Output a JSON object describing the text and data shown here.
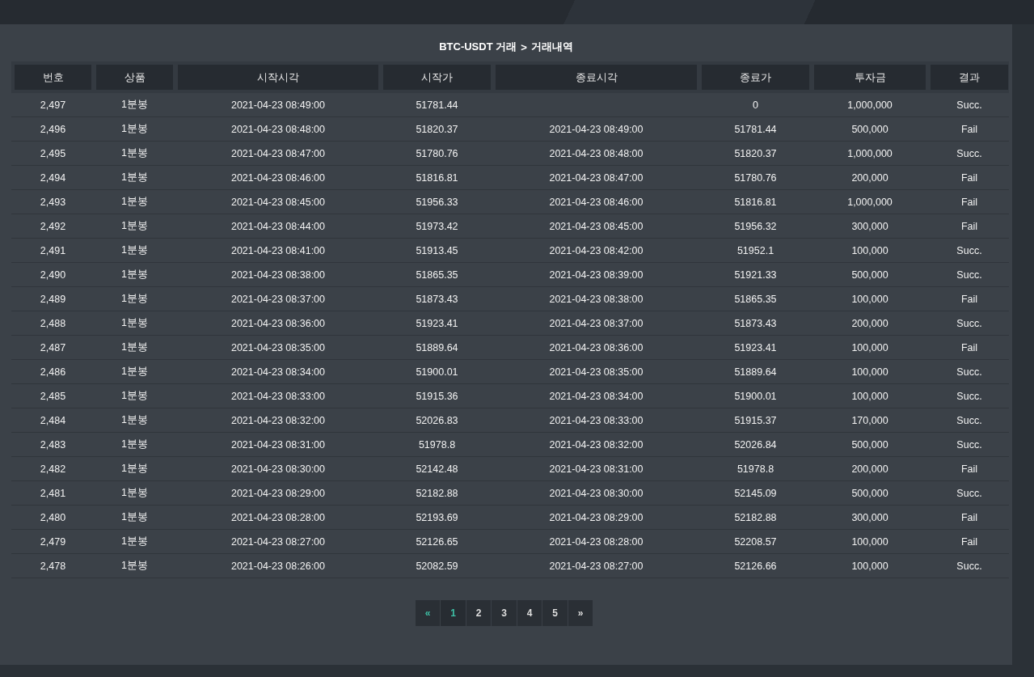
{
  "breadcrumb": {
    "title": "BTC-USDT 거래",
    "separator": ">",
    "current": "거래내역"
  },
  "table": {
    "columns": [
      "번호",
      "상품",
      "시작시각",
      "시작가",
      "종료시각",
      "종료가",
      "투자금",
      "결과"
    ],
    "rows": [
      [
        "2,497",
        "1분봉",
        "2021-04-23 08:49:00",
        "51781.44",
        "",
        "0",
        "1,000,000",
        "Succ."
      ],
      [
        "2,496",
        "1분봉",
        "2021-04-23 08:48:00",
        "51820.37",
        "2021-04-23 08:49:00",
        "51781.44",
        "500,000",
        "Fail"
      ],
      [
        "2,495",
        "1분봉",
        "2021-04-23 08:47:00",
        "51780.76",
        "2021-04-23 08:48:00",
        "51820.37",
        "1,000,000",
        "Succ."
      ],
      [
        "2,494",
        "1분봉",
        "2021-04-23 08:46:00",
        "51816.81",
        "2021-04-23 08:47:00",
        "51780.76",
        "200,000",
        "Fail"
      ],
      [
        "2,493",
        "1분봉",
        "2021-04-23 08:45:00",
        "51956.33",
        "2021-04-23 08:46:00",
        "51816.81",
        "1,000,000",
        "Fail"
      ],
      [
        "2,492",
        "1분봉",
        "2021-04-23 08:44:00",
        "51973.42",
        "2021-04-23 08:45:00",
        "51956.32",
        "300,000",
        "Fail"
      ],
      [
        "2,491",
        "1분봉",
        "2021-04-23 08:41:00",
        "51913.45",
        "2021-04-23 08:42:00",
        "51952.1",
        "100,000",
        "Succ."
      ],
      [
        "2,490",
        "1분봉",
        "2021-04-23 08:38:00",
        "51865.35",
        "2021-04-23 08:39:00",
        "51921.33",
        "500,000",
        "Succ."
      ],
      [
        "2,489",
        "1분봉",
        "2021-04-23 08:37:00",
        "51873.43",
        "2021-04-23 08:38:00",
        "51865.35",
        "100,000",
        "Fail"
      ],
      [
        "2,488",
        "1분봉",
        "2021-04-23 08:36:00",
        "51923.41",
        "2021-04-23 08:37:00",
        "51873.43",
        "200,000",
        "Succ."
      ],
      [
        "2,487",
        "1분봉",
        "2021-04-23 08:35:00",
        "51889.64",
        "2021-04-23 08:36:00",
        "51923.41",
        "100,000",
        "Fail"
      ],
      [
        "2,486",
        "1분봉",
        "2021-04-23 08:34:00",
        "51900.01",
        "2021-04-23 08:35:00",
        "51889.64",
        "100,000",
        "Succ."
      ],
      [
        "2,485",
        "1분봉",
        "2021-04-23 08:33:00",
        "51915.36",
        "2021-04-23 08:34:00",
        "51900.01",
        "100,000",
        "Succ."
      ],
      [
        "2,484",
        "1분봉",
        "2021-04-23 08:32:00",
        "52026.83",
        "2021-04-23 08:33:00",
        "51915.37",
        "170,000",
        "Succ."
      ],
      [
        "2,483",
        "1분봉",
        "2021-04-23 08:31:00",
        "51978.8",
        "2021-04-23 08:32:00",
        "52026.84",
        "500,000",
        "Succ."
      ],
      [
        "2,482",
        "1분봉",
        "2021-04-23 08:30:00",
        "52142.48",
        "2021-04-23 08:31:00",
        "51978.8",
        "200,000",
        "Fail"
      ],
      [
        "2,481",
        "1분봉",
        "2021-04-23 08:29:00",
        "52182.88",
        "2021-04-23 08:30:00",
        "52145.09",
        "500,000",
        "Succ."
      ],
      [
        "2,480",
        "1분봉",
        "2021-04-23 08:28:00",
        "52193.69",
        "2021-04-23 08:29:00",
        "52182.88",
        "300,000",
        "Fail"
      ],
      [
        "2,479",
        "1분봉",
        "2021-04-23 08:27:00",
        "52126.65",
        "2021-04-23 08:28:00",
        "52208.57",
        "100,000",
        "Fail"
      ],
      [
        "2,478",
        "1분봉",
        "2021-04-23 08:26:00",
        "52082.59",
        "2021-04-23 08:27:00",
        "52126.66",
        "100,000",
        "Succ."
      ]
    ]
  },
  "pagination": [
    {
      "label": "«",
      "kind": "prev"
    },
    {
      "label": "1",
      "kind": "page",
      "selected": true
    },
    {
      "label": "2",
      "kind": "page",
      "selected": false
    },
    {
      "label": "3",
      "kind": "page",
      "selected": false
    },
    {
      "label": "4",
      "kind": "page",
      "selected": false
    },
    {
      "label": "5",
      "kind": "page",
      "selected": false
    },
    {
      "label": "»",
      "kind": "next"
    }
  ]
}
